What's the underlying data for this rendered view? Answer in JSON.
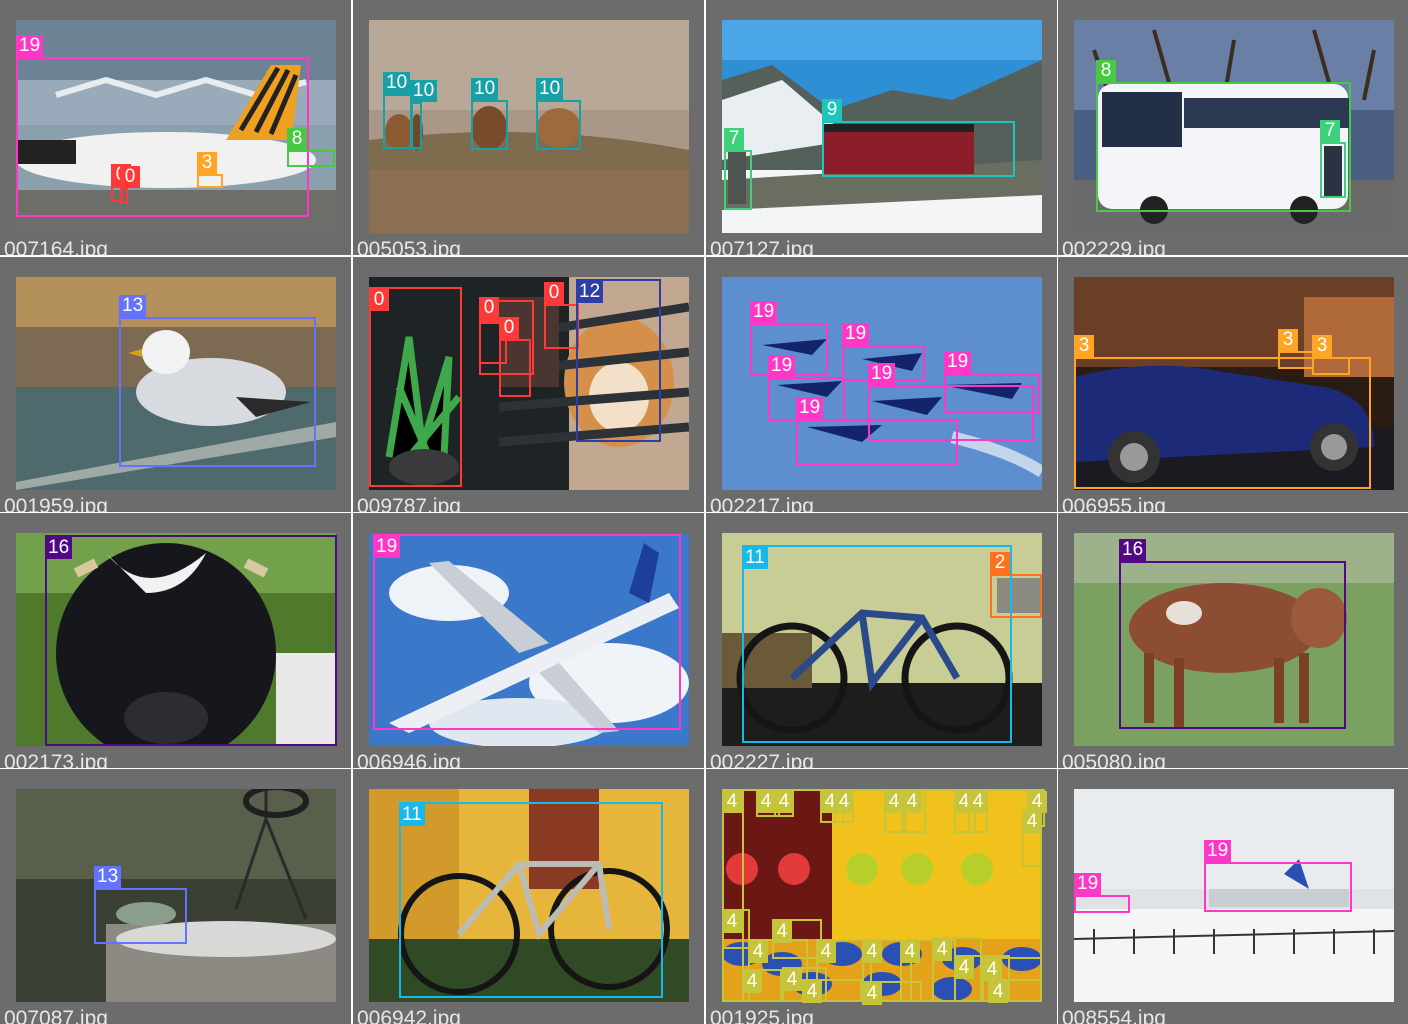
{
  "title": "",
  "tiles": [
    {
      "filename": "007164.jpg",
      "scene": "airport",
      "boxes": [
        {
          "cls": "19",
          "color": "#ff37c7"
        },
        {
          "cls": "8",
          "color": "#48c843"
        },
        {
          "cls": "3",
          "color": "#ffa526"
        },
        {
          "cls": "0",
          "color": "#ff3838"
        },
        {
          "cls": "0",
          "color": "#ff3838"
        }
      ]
    },
    {
      "filename": "005053.jpg",
      "scene": "field",
      "boxes": [
        {
          "cls": "10",
          "color": "#17a0a6"
        },
        {
          "cls": "10",
          "color": "#17a0a6"
        },
        {
          "cls": "10",
          "color": "#17a0a6"
        },
        {
          "cls": "10",
          "color": "#17a0a6"
        }
      ]
    },
    {
      "filename": "007127.jpg",
      "scene": "mountain",
      "boxes": [
        {
          "cls": "9",
          "color": "#1fc5bc"
        },
        {
          "cls": "7",
          "color": "#3dd17c"
        }
      ]
    },
    {
      "filename": "002229.jpg",
      "scene": "bus",
      "boxes": [
        {
          "cls": "8",
          "color": "#48c843"
        },
        {
          "cls": "7",
          "color": "#3dd17c"
        }
      ]
    },
    {
      "filename": "001959.jpg",
      "scene": "gull",
      "boxes": [
        {
          "cls": "13",
          "color": "#6473ff"
        }
      ]
    },
    {
      "filename": "009787.jpg",
      "scene": "dog",
      "boxes": [
        {
          "cls": "0",
          "color": "#ff3838"
        },
        {
          "cls": "0",
          "color": "#ff3838"
        },
        {
          "cls": "0",
          "color": "#ff3838"
        },
        {
          "cls": "0",
          "color": "#ff3838"
        },
        {
          "cls": "0",
          "color": "#ff3838"
        },
        {
          "cls": "12",
          "color": "#2c3fa6"
        }
      ]
    },
    {
      "filename": "002217.jpg",
      "scene": "jets",
      "boxes": [
        {
          "cls": "19",
          "color": "#ff37c7"
        },
        {
          "cls": "19",
          "color": "#ff37c7"
        },
        {
          "cls": "19",
          "color": "#ff37c7"
        },
        {
          "cls": "19",
          "color": "#ff37c7"
        },
        {
          "cls": "19",
          "color": "#ff37c7"
        },
        {
          "cls": "19",
          "color": "#ff37c7"
        }
      ]
    },
    {
      "filename": "006955.jpg",
      "scene": "car",
      "boxes": [
        {
          "cls": "3",
          "color": "#ffa526"
        },
        {
          "cls": "3",
          "color": "#ffa526"
        },
        {
          "cls": "3",
          "color": "#ffa526"
        }
      ]
    },
    {
      "filename": "002173.jpg",
      "scene": "cow",
      "boxes": [
        {
          "cls": "16",
          "color": "#520885"
        }
      ]
    },
    {
      "filename": "006946.jpg",
      "scene": "plane",
      "boxes": [
        {
          "cls": "19",
          "color": "#ff37c7"
        }
      ]
    },
    {
      "filename": "002227.jpg",
      "scene": "bike",
      "boxes": [
        {
          "cls": "11",
          "color": "#17b8ea"
        },
        {
          "cls": "2",
          "color": "#ff701f"
        }
      ]
    },
    {
      "filename": "005080.jpg",
      "scene": "calf",
      "boxes": [
        {
          "cls": "16",
          "color": "#520885"
        }
      ]
    },
    {
      "filename": "007087.jpg",
      "scene": "bird",
      "boxes": [
        {
          "cls": "13",
          "color": "#6473ff"
        }
      ]
    },
    {
      "filename": "006942.jpg",
      "scene": "hallbike",
      "boxes": [
        {
          "cls": "11",
          "color": "#17b8ea"
        }
      ]
    },
    {
      "filename": "001925.jpg",
      "scene": "bottles",
      "boxes": [
        {
          "cls": "4",
          "color": "#c5c43a"
        }
      ]
    },
    {
      "filename": "008554.jpg",
      "scene": "snowplane",
      "boxes": [
        {
          "cls": "19",
          "color": "#ff37c7"
        },
        {
          "cls": "19",
          "color": "#ff37c7"
        }
      ]
    }
  ]
}
